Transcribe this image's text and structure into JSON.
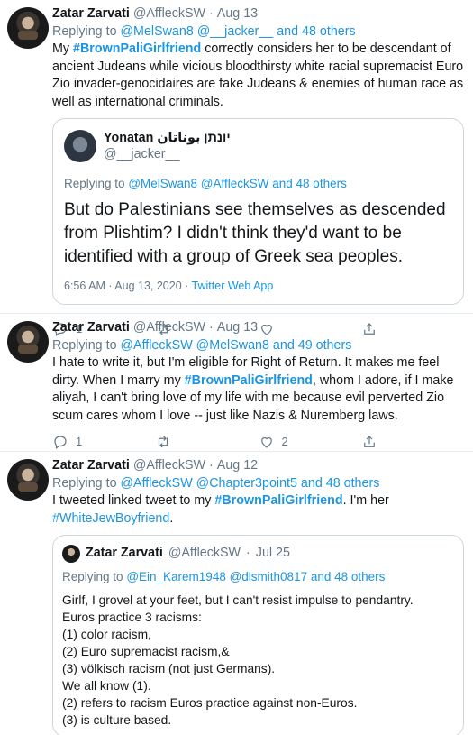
{
  "tweets": [
    {
      "name": "Zatar Zarvati",
      "handle": "@AffleckSW",
      "date": "Aug 13",
      "replying_prefix": "Replying to",
      "replying_users": "@MelSwan8 @__jacker__",
      "replying_suffix": "and 48 others",
      "text_pre": "My ",
      "hashtag": "#BrownPaliGirlfriend",
      "text_post": " correctly considers her to be descendant of ancient Judeans while vicious bloodthirsty white racial supremacist Euro Zio invader-genocidaires are fake Judeans & enemies of human race as well as international criminals.",
      "quote": {
        "name": "Yonatan יונתן بوناتان",
        "handle": "@__jacker__",
        "replying_prefix": "Replying to",
        "replying_users": "@MelSwan8 @AffleckSW and 48 others",
        "text": "But do Palestinians see themselves as descended from Plishtim? I didn't think they'd want to be identified with a group of Greek sea peoples.",
        "time": "6:56 AM · Aug 13, 2020 · ",
        "source": "Twitter Web App"
      },
      "actions": {
        "reply": "1",
        "retweet": "",
        "like": ""
      }
    },
    {
      "name": "Zatar Zarvati",
      "handle": "@AffleckSW",
      "date": "Aug 13",
      "replying_prefix": "Replying to",
      "replying_users": "@AffleckSW @MelSwan8 and 49 others",
      "text_pre": "I hate to write it, but I'm eligible for Right of Return. It makes me feel dirty. When I marry my ",
      "hashtag": "#BrownPaliGirlfriend",
      "text_post": ", whom I adore, if I make aliyah, I can't bring love of my life with me because evil perverted Zio scum cares whom I love -- just like Nazis & Nuremberg laws.",
      "actions": {
        "reply": "1",
        "retweet": "",
        "like": "2"
      }
    },
    {
      "name": "Zatar Zarvati",
      "handle": "@AffleckSW",
      "date": "Aug 12",
      "replying_prefix": "Replying to",
      "replying_users": "@AffleckSW @Chapter3point5 and 48 others",
      "text_pre": "I tweeted linked tweet to my ",
      "hashtag": "#BrownPaliGirlfriend",
      "text_mid": ". I'm her ",
      "hashtag2": "#WhiteJewBoyfriend",
      "text_post": ".",
      "quote": {
        "name": "Zatar Zarvati",
        "handle": "@AffleckSW",
        "date": "Jul 25",
        "replying_prefix": "Replying to",
        "replying_users": "@Ein_Karem1948 @dlsmith0817 and 48 others",
        "lines": [
          "Girlf, I grovel at your feet, but I can't resist impulse to pendantry.",
          "Euros practice 3 racisms:",
          "(1) color racism,",
          "(2) Euro supremacist racism,&",
          "(3) völkisch racism (not just Germans).",
          "We all know (1).",
          "(2) refers to racism Euros practice against non-Euros.",
          "(3) is culture based."
        ]
      }
    }
  ]
}
